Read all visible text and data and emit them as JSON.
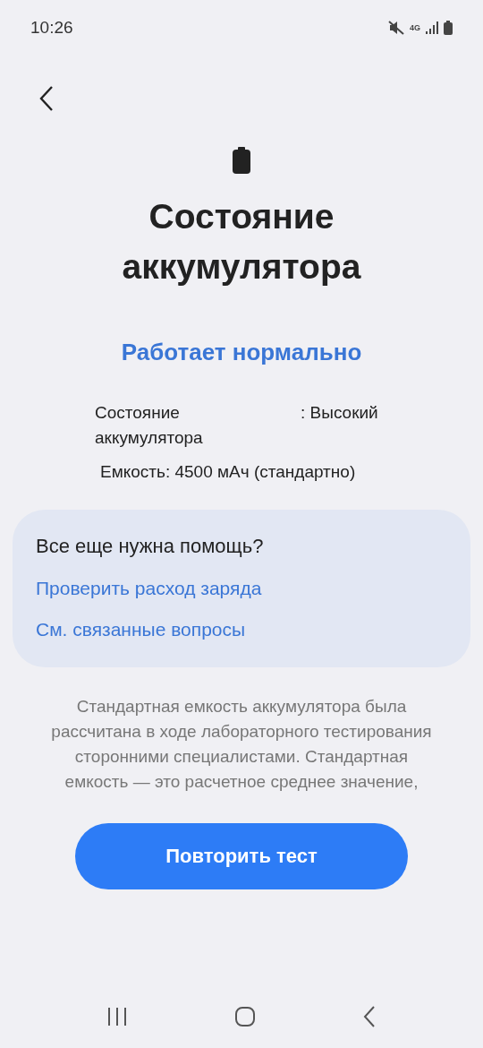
{
  "status_bar": {
    "time": "10:26",
    "network": "4G"
  },
  "title": "Состояние аккумулятора",
  "status": "Работает нормально",
  "details": {
    "health_label": "Состояние аккумулятора",
    "health_value": ": Высокий",
    "capacity": "Емкость: 4500 мАч (стандартно)"
  },
  "help_card": {
    "heading": "Все еще нужна помощь?",
    "links": [
      "Проверить расход заряда",
      "См. связанные вопросы"
    ]
  },
  "note": "Стандартная емкость аккумулятора была рассчитана в ходе лабораторного тестирования сторонними специалистами. Стандартная емкость — это расчетное среднее значение,",
  "button": "Повторить тест"
}
